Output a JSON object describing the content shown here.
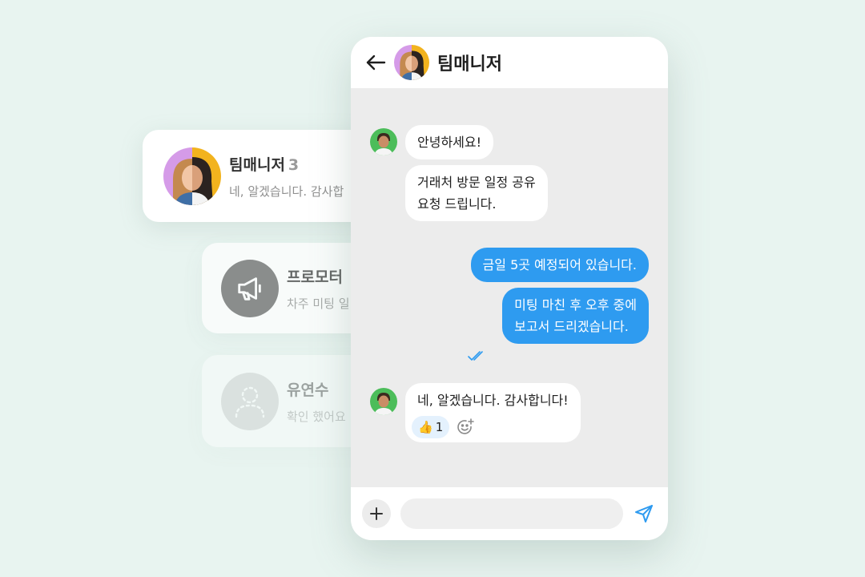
{
  "chat_list": [
    {
      "title": "팀매니저",
      "count": "3",
      "preview": "네, 알겠습니다. 감사합",
      "avatar": "group-avatar"
    },
    {
      "title": "프로모터",
      "preview": "차주 미팅 일",
      "avatar": "megaphone-icon"
    },
    {
      "title": "유연수",
      "preview": "확인 했어요",
      "avatar": "default-user-icon"
    }
  ],
  "chat": {
    "title": "팀매니저",
    "messages": [
      {
        "from": "them",
        "text": "안녕하세요!"
      },
      {
        "from": "them",
        "lines": [
          "거래처 방문 일정 공유",
          "요청 드립니다."
        ]
      },
      {
        "from": "me",
        "text": "금일 5곳 예정되어 있습니다."
      },
      {
        "from": "me",
        "lines": [
          "미팅 마친 후 오후 중에",
          "보고서 드리겠습니다."
        ],
        "status": "read"
      },
      {
        "from": "them",
        "text": "네, 알겠습니다. 감사합니다!",
        "reaction": {
          "emoji": "👍",
          "count": "1"
        }
      }
    ],
    "input": {
      "value": "",
      "placeholder": ""
    }
  },
  "colors": {
    "background": "#e8f4f0",
    "outgoing_bubble": "#2e9bf0",
    "incoming_bubble": "#ffffff",
    "chat_area": "#ececec",
    "reaction_pill": "#e4f1fd",
    "accent": "#2e9bf0"
  },
  "icons": [
    "back-arrow-icon",
    "megaphone-icon",
    "default-user-icon",
    "double-check-icon",
    "add-emoji-icon",
    "plus-icon",
    "send-icon"
  ]
}
